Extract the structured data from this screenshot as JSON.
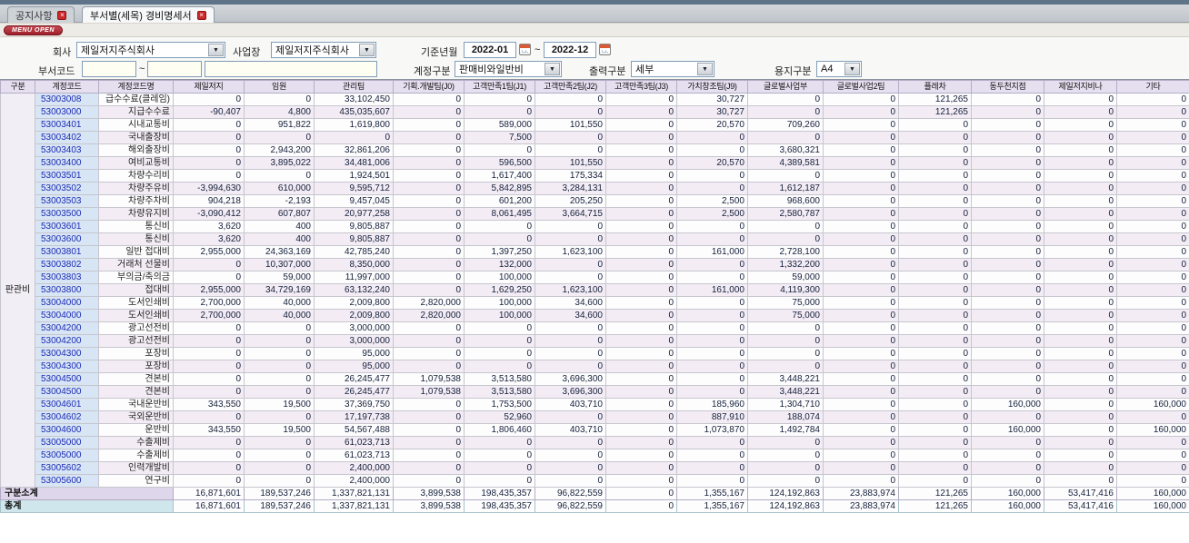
{
  "window": {
    "menu_open_label": "MENU OPEN",
    "tabs": [
      {
        "label": "공지사항",
        "active": false
      },
      {
        "label": "부서별(세목) 경비명세서",
        "active": true
      }
    ]
  },
  "filters": {
    "company_label": "회사",
    "company_value": "제일저지주식회사",
    "site_label": "사업장",
    "site_value": "제일저지주식회사",
    "period_label": "기준년월",
    "period_from": "2022-01",
    "period_to": "2022-12",
    "tilde": "~",
    "dept_code_label": "부서코드",
    "dept_from": "",
    "dept_to": "",
    "dept_name": "",
    "account_label": "계정구분",
    "account_value": "판매비와일반비",
    "output_label": "출력구분",
    "output_value": "세부",
    "paper_label": "용지구분",
    "paper_value": "A4"
  },
  "colors": {
    "header_bg": "#e5dff0",
    "row_alt_bg": "#f3ecf5",
    "code_col_bg": "#d8e5f5",
    "code_text": "#1d2db5",
    "subtotal_bg": "#ded6ea",
    "total_bg": "#cfe6ec",
    "menu_open_red": "#9e1f2c",
    "tab_close_red": "#cc2a2a"
  },
  "table": {
    "group_label": "판관비",
    "columns": [
      "구분",
      "계정코드",
      "계정코드명",
      "제일저지",
      "임원",
      "관리팀",
      "기획.개발팀(J0)",
      "고객만족1팀(J1)",
      "고객만족2팀(J2)",
      "고객만족3팀(J3)",
      "가치창조팀(J9)",
      "글로벌사업부",
      "글로벌사업2팀",
      "플레차",
      "동두천지점",
      "제일저지비나",
      "기타"
    ],
    "rows": [
      {
        "code": "53003008",
        "name": "급수수료(클레임)",
        "values": [
          "0",
          "0",
          "33,102,450",
          "0",
          "0",
          "0",
          "0",
          "30,727",
          "0",
          "0",
          "121,265",
          "0",
          "0",
          "0"
        ]
      },
      {
        "code": "53003000",
        "name": "지급수수료",
        "values": [
          "-90,407",
          "4,800",
          "435,035,607",
          "0",
          "0",
          "0",
          "0",
          "30,727",
          "0",
          "0",
          "121,265",
          "0",
          "0",
          "0"
        ]
      },
      {
        "code": "53003401",
        "name": "시내교통비",
        "values": [
          "0",
          "951,822",
          "1,619,800",
          "0",
          "589,000",
          "101,550",
          "0",
          "20,570",
          "709,260",
          "0",
          "0",
          "0",
          "0",
          "0"
        ]
      },
      {
        "code": "53003402",
        "name": "국내출장비",
        "values": [
          "0",
          "0",
          "0",
          "0",
          "7,500",
          "0",
          "0",
          "0",
          "0",
          "0",
          "0",
          "0",
          "0",
          "0"
        ]
      },
      {
        "code": "53003403",
        "name": "해외출장비",
        "values": [
          "0",
          "2,943,200",
          "32,861,206",
          "0",
          "0",
          "0",
          "0",
          "0",
          "3,680,321",
          "0",
          "0",
          "0",
          "0",
          "0"
        ]
      },
      {
        "code": "53003400",
        "name": "여비교통비",
        "values": [
          "0",
          "3,895,022",
          "34,481,006",
          "0",
          "596,500",
          "101,550",
          "0",
          "20,570",
          "4,389,581",
          "0",
          "0",
          "0",
          "0",
          "0"
        ]
      },
      {
        "code": "53003501",
        "name": "차량수리비",
        "values": [
          "0",
          "0",
          "1,924,501",
          "0",
          "1,617,400",
          "175,334",
          "0",
          "0",
          "0",
          "0",
          "0",
          "0",
          "0",
          "0"
        ]
      },
      {
        "code": "53003502",
        "name": "차량주유비",
        "values": [
          "-3,994,630",
          "610,000",
          "9,595,712",
          "0",
          "5,842,895",
          "3,284,131",
          "0",
          "0",
          "1,612,187",
          "0",
          "0",
          "0",
          "0",
          "0"
        ]
      },
      {
        "code": "53003503",
        "name": "차량주차비",
        "values": [
          "904,218",
          "-2,193",
          "9,457,045",
          "0",
          "601,200",
          "205,250",
          "0",
          "2,500",
          "968,600",
          "0",
          "0",
          "0",
          "0",
          "0"
        ]
      },
      {
        "code": "53003500",
        "name": "차량유지비",
        "values": [
          "-3,090,412",
          "607,807",
          "20,977,258",
          "0",
          "8,061,495",
          "3,664,715",
          "0",
          "2,500",
          "2,580,787",
          "0",
          "0",
          "0",
          "0",
          "0"
        ]
      },
      {
        "code": "53003601",
        "name": "통신비",
        "values": [
          "3,620",
          "400",
          "9,805,887",
          "0",
          "0",
          "0",
          "0",
          "0",
          "0",
          "0",
          "0",
          "0",
          "0",
          "0"
        ]
      },
      {
        "code": "53003600",
        "name": "통신비",
        "values": [
          "3,620",
          "400",
          "9,805,887",
          "0",
          "0",
          "0",
          "0",
          "0",
          "0",
          "0",
          "0",
          "0",
          "0",
          "0"
        ]
      },
      {
        "code": "53003801",
        "name": "일반 접대비",
        "values": [
          "2,955,000",
          "24,363,169",
          "42,785,240",
          "0",
          "1,397,250",
          "1,623,100",
          "0",
          "161,000",
          "2,728,100",
          "0",
          "0",
          "0",
          "0",
          "0"
        ]
      },
      {
        "code": "53003802",
        "name": "거래처 선물비",
        "values": [
          "0",
          "10,307,000",
          "8,350,000",
          "0",
          "132,000",
          "0",
          "0",
          "0",
          "1,332,200",
          "0",
          "0",
          "0",
          "0",
          "0"
        ]
      },
      {
        "code": "53003803",
        "name": "부의금/축의금",
        "values": [
          "0",
          "59,000",
          "11,997,000",
          "0",
          "100,000",
          "0",
          "0",
          "0",
          "59,000",
          "0",
          "0",
          "0",
          "0",
          "0"
        ]
      },
      {
        "code": "53003800",
        "name": "접대비",
        "values": [
          "2,955,000",
          "34,729,169",
          "63,132,240",
          "0",
          "1,629,250",
          "1,623,100",
          "0",
          "161,000",
          "4,119,300",
          "0",
          "0",
          "0",
          "0",
          "0"
        ]
      },
      {
        "code": "53004000",
        "name": "도서인쇄비",
        "values": [
          "2,700,000",
          "40,000",
          "2,009,800",
          "2,820,000",
          "100,000",
          "34,600",
          "0",
          "0",
          "75,000",
          "0",
          "0",
          "0",
          "0",
          "0"
        ]
      },
      {
        "code": "53004000",
        "name": "도서인쇄비",
        "values": [
          "2,700,000",
          "40,000",
          "2,009,800",
          "2,820,000",
          "100,000",
          "34,600",
          "0",
          "0",
          "75,000",
          "0",
          "0",
          "0",
          "0",
          "0"
        ]
      },
      {
        "code": "53004200",
        "name": "광고선전비",
        "values": [
          "0",
          "0",
          "3,000,000",
          "0",
          "0",
          "0",
          "0",
          "0",
          "0",
          "0",
          "0",
          "0",
          "0",
          "0"
        ]
      },
      {
        "code": "53004200",
        "name": "광고선전비",
        "values": [
          "0",
          "0",
          "3,000,000",
          "0",
          "0",
          "0",
          "0",
          "0",
          "0",
          "0",
          "0",
          "0",
          "0",
          "0"
        ]
      },
      {
        "code": "53004300",
        "name": "포장비",
        "values": [
          "0",
          "0",
          "95,000",
          "0",
          "0",
          "0",
          "0",
          "0",
          "0",
          "0",
          "0",
          "0",
          "0",
          "0"
        ]
      },
      {
        "code": "53004300",
        "name": "포장비",
        "values": [
          "0",
          "0",
          "95,000",
          "0",
          "0",
          "0",
          "0",
          "0",
          "0",
          "0",
          "0",
          "0",
          "0",
          "0"
        ]
      },
      {
        "code": "53004500",
        "name": "견본비",
        "values": [
          "0",
          "0",
          "26,245,477",
          "1,079,538",
          "3,513,580",
          "3,696,300",
          "0",
          "0",
          "3,448,221",
          "0",
          "0",
          "0",
          "0",
          "0"
        ]
      },
      {
        "code": "53004500",
        "name": "견본비",
        "values": [
          "0",
          "0",
          "26,245,477",
          "1,079,538",
          "3,513,580",
          "3,696,300",
          "0",
          "0",
          "3,448,221",
          "0",
          "0",
          "0",
          "0",
          "0"
        ]
      },
      {
        "code": "53004601",
        "name": "국내운반비",
        "values": [
          "343,550",
          "19,500",
          "37,369,750",
          "0",
          "1,753,500",
          "403,710",
          "0",
          "185,960",
          "1,304,710",
          "0",
          "0",
          "160,000",
          "0",
          "160,000"
        ]
      },
      {
        "code": "53004602",
        "name": "국외운반비",
        "values": [
          "0",
          "0",
          "17,197,738",
          "0",
          "52,960",
          "0",
          "0",
          "887,910",
          "188,074",
          "0",
          "0",
          "0",
          "0",
          "0"
        ]
      },
      {
        "code": "53004600",
        "name": "운반비",
        "values": [
          "343,550",
          "19,500",
          "54,567,488",
          "0",
          "1,806,460",
          "403,710",
          "0",
          "1,073,870",
          "1,492,784",
          "0",
          "0",
          "160,000",
          "0",
          "160,000"
        ]
      },
      {
        "code": "53005000",
        "name": "수출제비",
        "values": [
          "0",
          "0",
          "61,023,713",
          "0",
          "0",
          "0",
          "0",
          "0",
          "0",
          "0",
          "0",
          "0",
          "0",
          "0"
        ]
      },
      {
        "code": "53005000",
        "name": "수출제비",
        "values": [
          "0",
          "0",
          "61,023,713",
          "0",
          "0",
          "0",
          "0",
          "0",
          "0",
          "0",
          "0",
          "0",
          "0",
          "0"
        ]
      },
      {
        "code": "53005602",
        "name": "인력개발비",
        "values": [
          "0",
          "0",
          "2,400,000",
          "0",
          "0",
          "0",
          "0",
          "0",
          "0",
          "0",
          "0",
          "0",
          "0",
          "0"
        ]
      },
      {
        "code": "53005600",
        "name": "연구비",
        "values": [
          "0",
          "0",
          "2,400,000",
          "0",
          "0",
          "0",
          "0",
          "0",
          "0",
          "0",
          "0",
          "0",
          "0",
          "0"
        ]
      }
    ],
    "footers": [
      {
        "label": "구분소계",
        "values": [
          "16,871,601",
          "189,537,246",
          "1,337,821,131",
          "3,899,538",
          "198,435,357",
          "96,822,559",
          "0",
          "1,355,167",
          "124,192,863",
          "23,883,974",
          "121,265",
          "160,000",
          "53,417,416",
          "160,000"
        ]
      },
      {
        "label": "총계",
        "values": [
          "16,871,601",
          "189,537,246",
          "1,337,821,131",
          "3,899,538",
          "198,435,357",
          "96,822,559",
          "0",
          "1,355,167",
          "124,192,863",
          "23,883,974",
          "121,265",
          "160,000",
          "53,417,416",
          "160,000"
        ]
      }
    ]
  }
}
